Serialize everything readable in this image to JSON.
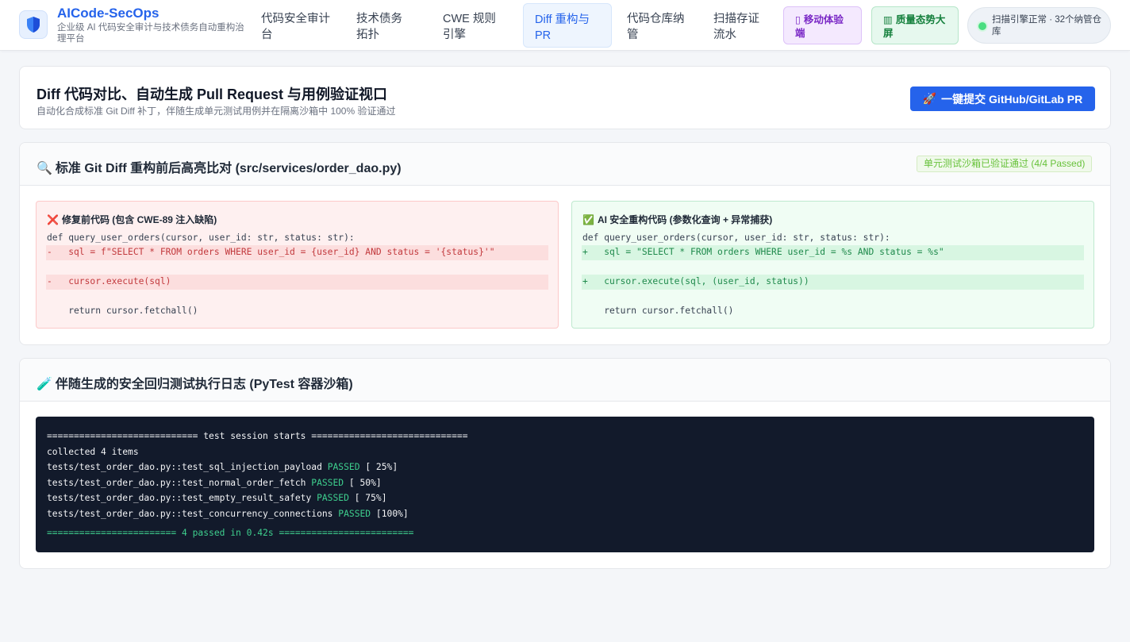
{
  "header": {
    "brand": "AICode-SecOps",
    "tagline": "企业级 AI 代码安全审计与技术债务自动重构治理平台",
    "logo_icon": "shield-icon",
    "nav": [
      {
        "label": "代码安全审计台"
      },
      {
        "label": "技术债务拓扑"
      },
      {
        "label": "CWE 规则引擎"
      },
      {
        "label": "Diff 重构与 PR",
        "active": true
      },
      {
        "label": "代码仓库纳管"
      },
      {
        "label": "扫描存证流水"
      }
    ],
    "mobile_btn": {
      "icon": "▯",
      "label": "移动体验端"
    },
    "dashboard_btn": {
      "icon": "▥",
      "label": "质量态势大屏"
    },
    "status": "扫描引擎正常 · 32个纳管仓库"
  },
  "hero": {
    "title": "Diff 代码对比、自动生成 Pull Request 与用例验证视口",
    "subtitle": "自动化合成标准 Git Diff 补丁，伴随生成单元测试用例并在隔离沙箱中 100% 验证通过",
    "pr_button_icon": "🚀",
    "pr_button": "一键提交 GitHub/GitLab PR"
  },
  "diff": {
    "icon": "🔍",
    "title": "标准 Git Diff 重构前后高亮比对 (src/services/order_dao.py)",
    "badge": "单元测试沙箱已验证通过 (4/4 Passed)",
    "before": {
      "icon": "❌",
      "title": "修复前代码 (包含 CWE-89 注入缺陷)",
      "lines": [
        "def query_user_orders(cursor, user_id: str, status: str):",
        "-   sql = f\"SELECT * FROM orders WHERE user_id = {user_id} AND status = '{status}'\"",
        "",
        "-   cursor.execute(sql)",
        "",
        "    return cursor.fetchall()"
      ]
    },
    "after": {
      "icon": "✅",
      "title": "AI 安全重构代码 (参数化查询 + 异常捕获)",
      "lines": [
        "def query_user_orders(cursor, user_id: str, status: str):",
        "+   sql = \"SELECT * FROM orders WHERE user_id = %s AND status = %s\"",
        "",
        "+   cursor.execute(sql, (user_id, status))",
        "",
        "    return cursor.fetchall()"
      ]
    }
  },
  "log": {
    "icon": "🧪",
    "title": "伴随生成的安全回归测试执行日志 (PyTest 容器沙箱)",
    "session_line": "============================ test session starts =============================",
    "collected": "collected 4 items",
    "tests": [
      {
        "name": "tests/test_order_dao.py::test_sql_injection_payload",
        "result": "PASSED",
        "progress": "[ 25%]"
      },
      {
        "name": "tests/test_order_dao.py::test_normal_order_fetch",
        "result": "PASSED",
        "progress": "[ 50%]"
      },
      {
        "name": "tests/test_order_dao.py::test_empty_result_safety",
        "result": "PASSED",
        "progress": "[ 75%]"
      },
      {
        "name": "tests/test_order_dao.py::test_concurrency_connections",
        "result": "PASSED",
        "progress": "[100%]"
      }
    ],
    "summary": "======================== 4 passed in 0.42s ========================="
  },
  "colors": {
    "accent": "#2563eb",
    "passed": "#3ecf8e",
    "deleted": "#c2393d",
    "added": "#1f8a4c"
  }
}
